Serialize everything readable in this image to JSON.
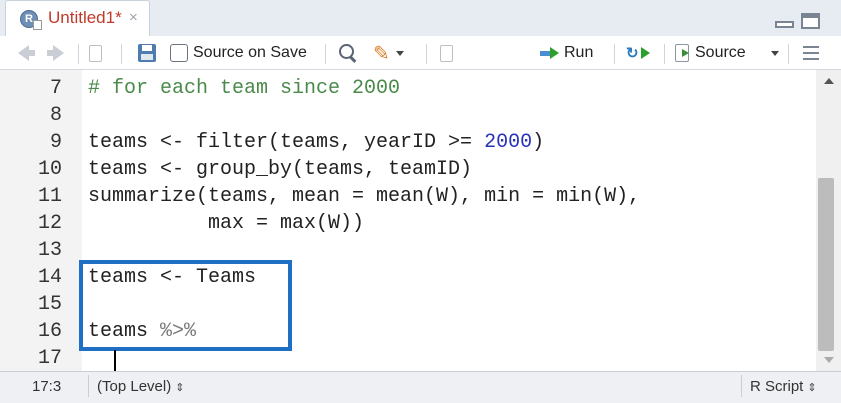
{
  "tab": {
    "title": "Untitled1*",
    "close": "×",
    "icon_letter": "R"
  },
  "toolbar": {
    "source_on_save": "Source on Save",
    "run": "Run",
    "source": "Source"
  },
  "editor": {
    "partial_top": "        `      ",
    "lines": [
      {
        "n": "7",
        "tokens": [
          {
            "t": "# for each team since 2000",
            "c": "comment"
          }
        ]
      },
      {
        "n": "8",
        "tokens": []
      },
      {
        "n": "9",
        "tokens": [
          {
            "t": "teams <- filter(teams, yearID >= ",
            "c": ""
          },
          {
            "t": "2000",
            "c": "num"
          },
          {
            "t": ")",
            "c": ""
          }
        ]
      },
      {
        "n": "10",
        "tokens": [
          {
            "t": "teams <- group_by(teams, teamID)",
            "c": ""
          }
        ]
      },
      {
        "n": "11",
        "tokens": [
          {
            "t": "summarize(teams, mean = mean(W), min = min(W),",
            "c": ""
          }
        ]
      },
      {
        "n": "12",
        "tokens": [
          {
            "t": "          max = max(W))",
            "c": ""
          }
        ]
      },
      {
        "n": "13",
        "tokens": []
      },
      {
        "n": "14",
        "tokens": [
          {
            "t": "teams <- Teams",
            "c": ""
          }
        ]
      },
      {
        "n": "15",
        "tokens": []
      },
      {
        "n": "16",
        "tokens": [
          {
            "t": "teams ",
            "c": ""
          },
          {
            "t": "%>%",
            "c": "op"
          }
        ]
      },
      {
        "n": "17",
        "tokens": []
      }
    ]
  },
  "status": {
    "position": "17:3",
    "scope": "(Top Level)",
    "file_type": "R Script",
    "updown": "⇕"
  },
  "colors": {
    "highlight_box": "#1f6fc5",
    "tab_title": "#c0392b"
  }
}
